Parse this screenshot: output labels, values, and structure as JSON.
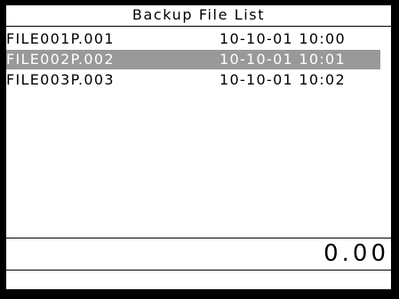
{
  "screen": {
    "title": "Backup File List",
    "files": [
      {
        "name": "FILE001P.001",
        "datetime": "10-10-01 10:00",
        "selected": false
      },
      {
        "name": "FILE002P.002",
        "datetime": "10-10-01 10:01",
        "selected": true
      },
      {
        "name": "FILE003P.003",
        "datetime": "10-10-01 10:02",
        "selected": false
      }
    ],
    "total": "0.00"
  },
  "colors": {
    "frame": "#000000",
    "background": "#ffffff",
    "selection": "#999999",
    "selection_text": "#ffffff"
  }
}
